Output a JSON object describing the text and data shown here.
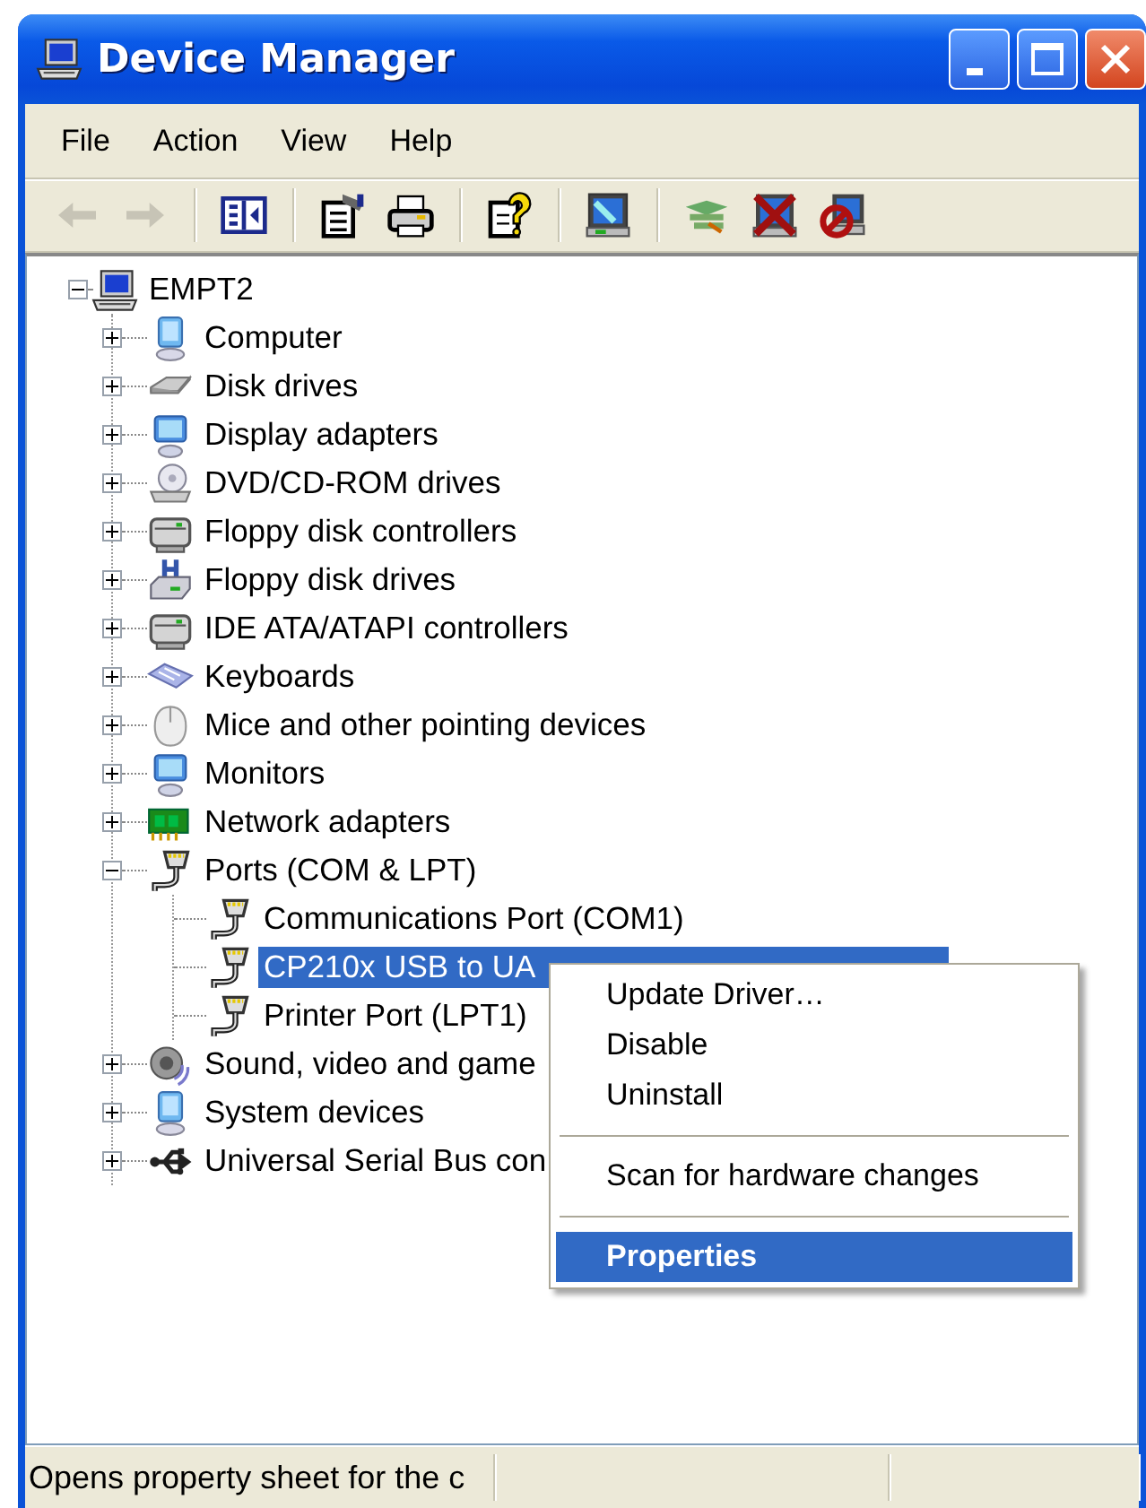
{
  "window": {
    "title": "Device Manager"
  },
  "menu_bar": [
    {
      "label": "File"
    },
    {
      "label": "Action"
    },
    {
      "label": "View"
    },
    {
      "label": "Help"
    }
  ],
  "toolbar": [
    [
      {
        "kind": "back",
        "disabled": true
      },
      {
        "kind": "forward",
        "disabled": true
      }
    ],
    [
      {
        "kind": "panel",
        "disabled": false
      }
    ],
    [
      {
        "kind": "properties",
        "disabled": false
      },
      {
        "kind": "print",
        "disabled": false
      }
    ],
    [
      {
        "kind": "help",
        "disabled": false
      }
    ],
    [
      {
        "kind": "scan",
        "disabled": false
      }
    ],
    [
      {
        "kind": "update",
        "disabled": false
      },
      {
        "kind": "uninstall",
        "disabled": false
      },
      {
        "kind": "disable",
        "disabled": false
      }
    ]
  ],
  "tree": {
    "label": "EMPT2",
    "kind": "computer-root",
    "expanded": true,
    "selected": false,
    "children": [
      {
        "label": "Computer",
        "kind": "computer",
        "expanded": false,
        "selected": false
      },
      {
        "label": "Disk drives",
        "kind": "disk",
        "expanded": false,
        "selected": false
      },
      {
        "label": "Display adapters",
        "kind": "display",
        "expanded": false,
        "selected": false
      },
      {
        "label": "DVD/CD-ROM drives",
        "kind": "dvd",
        "expanded": false,
        "selected": false
      },
      {
        "label": "Floppy disk controllers",
        "kind": "controller",
        "expanded": false,
        "selected": false
      },
      {
        "label": "Floppy disk drives",
        "kind": "floppy",
        "expanded": false,
        "selected": false
      },
      {
        "label": "IDE ATA/ATAPI controllers",
        "kind": "controller",
        "expanded": false,
        "selected": false
      },
      {
        "label": "Keyboards",
        "kind": "keyboard",
        "expanded": false,
        "selected": false
      },
      {
        "label": "Mice and other pointing devices",
        "kind": "mouse",
        "expanded": false,
        "selected": false
      },
      {
        "label": "Monitors",
        "kind": "display",
        "expanded": false,
        "selected": false
      },
      {
        "label": "Network adapters",
        "kind": "network",
        "expanded": false,
        "selected": false
      },
      {
        "label": "Ports (COM & LPT)",
        "kind": "port",
        "expanded": true,
        "selected": false,
        "children": [
          {
            "label": "Communications Port (COM1)",
            "kind": "port",
            "selected": false
          },
          {
            "label": "CP210x USB to UA",
            "kind": "port",
            "selected": true
          },
          {
            "label": "Printer Port (LPT1)",
            "kind": "port",
            "selected": false
          }
        ]
      },
      {
        "label": "Sound, video and game",
        "kind": "sound",
        "expanded": false,
        "selected": false
      },
      {
        "label": "System devices",
        "kind": "computer",
        "expanded": false,
        "selected": false
      },
      {
        "label": "Universal Serial Bus con",
        "kind": "usb",
        "expanded": false,
        "selected": false
      }
    ]
  },
  "context_menu": [
    {
      "kind": "item",
      "label": "Update Driver…",
      "selected": false
    },
    {
      "kind": "item",
      "label": "Disable",
      "selected": false
    },
    {
      "kind": "item",
      "label": "Uninstall",
      "selected": false
    },
    {
      "kind": "separator"
    },
    {
      "kind": "item",
      "label": "Scan for hardware changes",
      "selected": false
    },
    {
      "kind": "separator"
    },
    {
      "kind": "item",
      "label": "Properties",
      "selected": true
    }
  ],
  "status_bar": {
    "text": "Opens property sheet for the c"
  }
}
